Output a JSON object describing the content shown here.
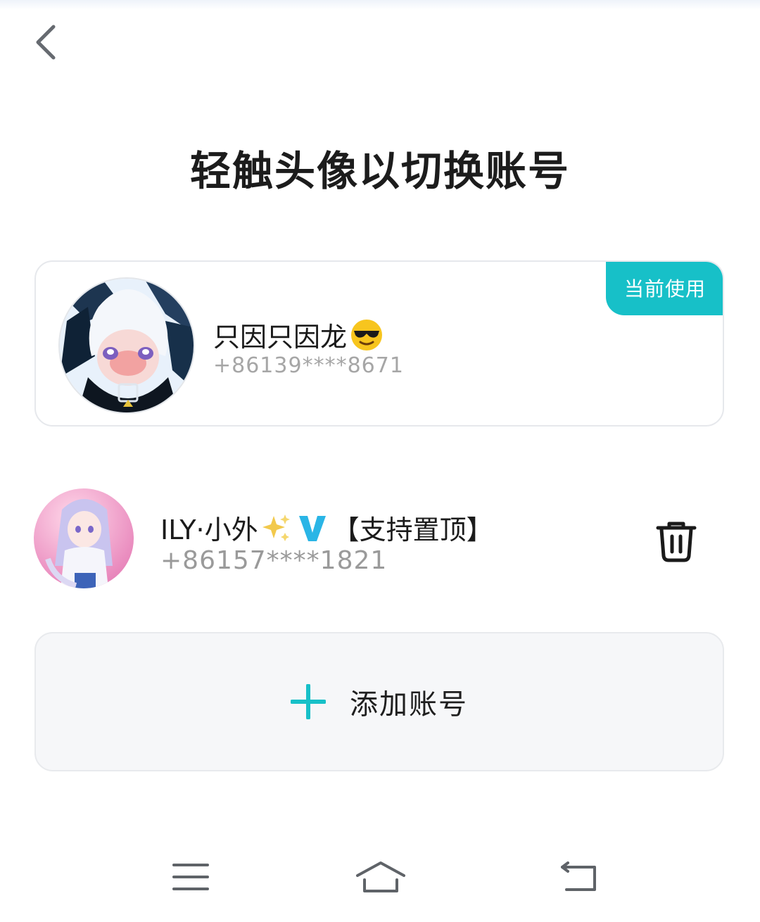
{
  "header": {
    "back_icon": "chevron-left-icon",
    "title": "轻触头像以切换账号"
  },
  "current_account": {
    "badge": "当前使用",
    "name": "只因只因龙",
    "name_emoji": "sunglasses-emoji",
    "phone": "+86139****8671"
  },
  "other_account": {
    "name": "ILY·小外",
    "name_suffix": "【支持置顶】",
    "sparkle_icon": "sparkles-emoji",
    "verified_icon": "verified-v-icon",
    "phone": "+86157****1821",
    "delete_icon": "trash-icon"
  },
  "add_account": {
    "label": "添加账号",
    "icon": "plus-icon"
  },
  "nav_bar": {
    "menu_icon": "menu-icon",
    "home_icon": "home-icon",
    "back_icon": "back-arrow-icon"
  },
  "colors": {
    "accent": "#17c0c8",
    "verified": "#2ab5e6",
    "secondary_text": "#a6a6a6"
  }
}
